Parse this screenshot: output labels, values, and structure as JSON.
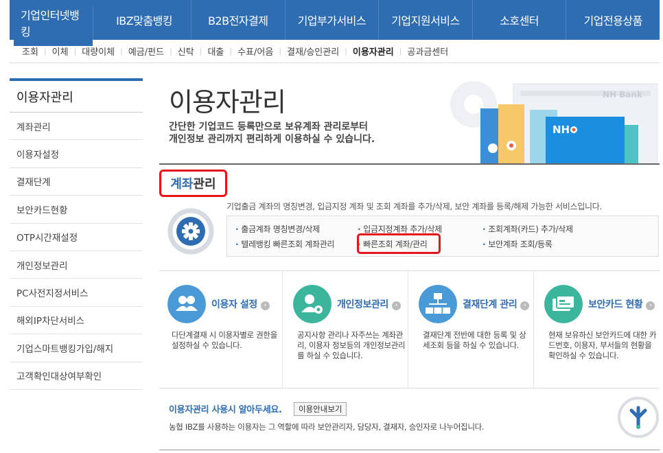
{
  "topnav": {
    "tabs": [
      {
        "label": "기업인터넷뱅킹"
      },
      {
        "label": "IBZ맞춤뱅킹"
      },
      {
        "label": "B2B전자결제"
      },
      {
        "label": "기업부가서비스"
      },
      {
        "label": "기업지원서비스"
      },
      {
        "label": "소호센터"
      },
      {
        "label": "기업전용상품"
      }
    ]
  },
  "subnav": {
    "items": [
      {
        "label": "조회"
      },
      {
        "label": "이체"
      },
      {
        "label": "대량이체"
      },
      {
        "label": "예금/펀드"
      },
      {
        "label": "신탁"
      },
      {
        "label": "대출"
      },
      {
        "label": "수표/어음"
      },
      {
        "label": "결재/승인관리"
      },
      {
        "label": "이용자관리"
      },
      {
        "label": "공과금센터"
      }
    ]
  },
  "sidebar": {
    "title": "이용자관리",
    "items": [
      {
        "label": "계좌관리"
      },
      {
        "label": "이용자설정"
      },
      {
        "label": "결재단계"
      },
      {
        "label": "보안카드현황"
      },
      {
        "label": "OTP시간재설정"
      },
      {
        "label": "개인정보관리"
      },
      {
        "label": "PC사전지정서비스"
      },
      {
        "label": "해외IP차단서비스"
      },
      {
        "label": "기업스마트뱅킹가입/해지"
      },
      {
        "label": "고객확인대상여부확인"
      }
    ]
  },
  "hero": {
    "title": "이용자관리",
    "sub1": "간단한 기업코드 등록만으로 보유계좌 관리로부터",
    "sub2": "개인정보 관리까지 편리하게 이용하실 수 있습니다.",
    "art_brand": "NH",
    "art_bank": "NH Bank"
  },
  "section": {
    "head_blue": "계좌",
    "head_rest": "관리",
    "desc": "기업출금 계좌의 명칭변경, 입금지정 계좌 및 조회 계좌를 추가/삭제, 보안 계좌를 등록/해제 가능한 서비스입니다.",
    "links": [
      {
        "label": "출금계좌 명칭변경/삭제"
      },
      {
        "label": "입금지정계좌 추가/삭제"
      },
      {
        "label": "조회계좌(카드) 추가/삭제"
      },
      {
        "label": "텔레뱅킹 빠른조회 계좌관리"
      },
      {
        "label": "빠른조회 계좌/관리"
      },
      {
        "label": "보안계좌 조회/등록"
      }
    ]
  },
  "cards": [
    {
      "title": "이용자 설정",
      "desc": "다단계결재 시 이용자별로 권한을 설정하실 수 있습니다.",
      "color": "#4a9ad8"
    },
    {
      "title": "개인정보관리",
      "desc": "공지사항 관리나 자주쓰는 계좌관리, 이용자 정보등의 개인정보관리를 하실 수 있습니다.",
      "color": "#3bb59b"
    },
    {
      "title": "결재단계 관리",
      "desc": "결재단계 전반에 대한 등록 및 상세조회 등을 하실 수 있습니다.",
      "color": "#4a9ad8"
    },
    {
      "title": "보안카드 현황",
      "desc": "현재 보유하신 보안카드에 대한 카드번호, 이용자, 부서들의 현황을 확인하실 수 있습니다.",
      "color": "#3bb59b"
    }
  ],
  "notice": {
    "title": "이용자관리 사용시 알아두세요.",
    "button": "이용안내보기",
    "text": "농협 IBZ를 사용하는 이용자는 그 역할에 따라 보안관리자, 담당자, 결재자, 승인자로 나누어집니다."
  },
  "colors": {
    "primary": "#2f6db3",
    "highlight": "#e8141b"
  }
}
